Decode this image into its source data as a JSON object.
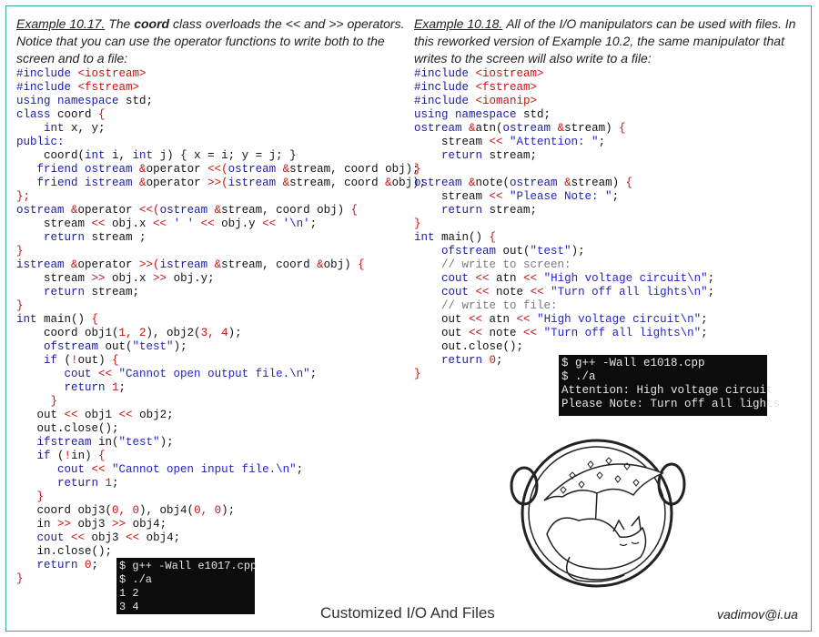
{
  "left": {
    "example_label": "Example 10.17.",
    "intro_pre": "The ",
    "intro_keyword": "coord",
    "intro_post": " class overloads the << and >> operators. Notice that you can use the operator functions to write both to the screen and to a file:",
    "code": [
      [
        [
          "k",
          "#include "
        ],
        [
          "r",
          "<iostream>"
        ]
      ],
      [
        [
          "k",
          "#include "
        ],
        [
          "r",
          "<fstream>"
        ]
      ],
      [
        [
          "k",
          "using namespace "
        ],
        [
          "t",
          "std;"
        ]
      ],
      [
        [
          "k",
          "class "
        ],
        [
          "t",
          "coord "
        ],
        [
          "r",
          "{"
        ]
      ],
      [
        [
          "t",
          "    "
        ],
        [
          "k",
          "int "
        ],
        [
          "t",
          "x, y;"
        ]
      ],
      [
        [
          "k",
          "public:"
        ]
      ],
      [
        [
          "t",
          "    coord("
        ],
        [
          "k",
          "int "
        ],
        [
          "t",
          "i, "
        ],
        [
          "k",
          "int "
        ],
        [
          "t",
          "j) { x = i; y = j; }"
        ]
      ],
      [
        [
          "t",
          "   "
        ],
        [
          "k",
          "friend ostream "
        ],
        [
          "r",
          "&"
        ],
        [
          "t",
          "operator "
        ],
        [
          "r",
          "<<("
        ],
        [
          "k",
          "ostream "
        ],
        [
          "r",
          "&"
        ],
        [
          "t",
          "stream, coord obj);"
        ]
      ],
      [
        [
          "t",
          "   "
        ],
        [
          "k",
          "friend istream "
        ],
        [
          "r",
          "&"
        ],
        [
          "t",
          "operator "
        ],
        [
          "r",
          ">>("
        ],
        [
          "k",
          "istream "
        ],
        [
          "r",
          "&"
        ],
        [
          "t",
          "stream, coord "
        ],
        [
          "r",
          "&"
        ],
        [
          "t",
          "obj);"
        ]
      ],
      [
        [
          "r",
          "};"
        ]
      ],
      [
        [
          "k",
          "ostream "
        ],
        [
          "r",
          "&"
        ],
        [
          "t",
          "operator "
        ],
        [
          "r",
          "<<("
        ],
        [
          "k",
          "ostream "
        ],
        [
          "r",
          "&"
        ],
        [
          "t",
          "stream, coord obj) "
        ],
        [
          "r",
          "{"
        ]
      ],
      [
        [
          "t",
          "    stream "
        ],
        [
          "r",
          "<< "
        ],
        [
          "t",
          "obj.x "
        ],
        [
          "r",
          "<< "
        ],
        [
          "s",
          "' ' "
        ],
        [
          "r",
          "<< "
        ],
        [
          "t",
          "obj.y "
        ],
        [
          "r",
          "<< "
        ],
        [
          "s",
          "'\\n'"
        ],
        [
          "t",
          ";"
        ]
      ],
      [
        [
          "t",
          "    "
        ],
        [
          "k",
          "return "
        ],
        [
          "t",
          "stream ;"
        ]
      ],
      [
        [
          "r",
          "}"
        ]
      ],
      [
        [
          "k",
          "istream "
        ],
        [
          "r",
          "&"
        ],
        [
          "t",
          "operator "
        ],
        [
          "r",
          ">>("
        ],
        [
          "k",
          "istream "
        ],
        [
          "r",
          "&"
        ],
        [
          "t",
          "stream, coord "
        ],
        [
          "r",
          "&"
        ],
        [
          "t",
          "obj) "
        ],
        [
          "r",
          "{"
        ]
      ],
      [
        [
          "t",
          "    stream "
        ],
        [
          "r",
          ">> "
        ],
        [
          "t",
          "obj.x "
        ],
        [
          "r",
          ">> "
        ],
        [
          "t",
          "obj.y;"
        ]
      ],
      [
        [
          "t",
          "    "
        ],
        [
          "k",
          "return "
        ],
        [
          "t",
          "stream;"
        ]
      ],
      [
        [
          "r",
          "}"
        ]
      ],
      [
        [
          "k",
          "int "
        ],
        [
          "t",
          "main() "
        ],
        [
          "r",
          "{"
        ]
      ],
      [
        [
          "t",
          "    coord obj1("
        ],
        [
          "r",
          "1, 2"
        ],
        [
          "t",
          "), obj2("
        ],
        [
          "r",
          "3, 4"
        ],
        [
          "t",
          ");"
        ]
      ],
      [
        [
          "t",
          "    "
        ],
        [
          "k",
          "ofstream "
        ],
        [
          "t",
          "out("
        ],
        [
          "s",
          "\"test\""
        ],
        [
          "t",
          ");"
        ]
      ],
      [
        [
          "t",
          "    "
        ],
        [
          "k",
          "if "
        ],
        [
          "t",
          "("
        ],
        [
          "r",
          "!"
        ],
        [
          "t",
          "out) "
        ],
        [
          "r",
          "{"
        ]
      ],
      [
        [
          "t",
          "       "
        ],
        [
          "k",
          "cout "
        ],
        [
          "r",
          "<< "
        ],
        [
          "s",
          "\"Cannot open output file.\\n\""
        ],
        [
          "t",
          ";"
        ]
      ],
      [
        [
          "t",
          "       "
        ],
        [
          "k",
          "return "
        ],
        [
          "r",
          "1"
        ],
        [
          "t",
          ";"
        ]
      ],
      [
        [
          "t",
          "     "
        ],
        [
          "r",
          "}"
        ]
      ],
      [
        [
          "t",
          "   out "
        ],
        [
          "r",
          "<< "
        ],
        [
          "t",
          "obj1 "
        ],
        [
          "r",
          "<< "
        ],
        [
          "t",
          "obj2;"
        ]
      ],
      [
        [
          "t",
          "   out.close();"
        ]
      ],
      [
        [
          "t",
          "   "
        ],
        [
          "k",
          "ifstream "
        ],
        [
          "t",
          "in("
        ],
        [
          "s",
          "\"test\""
        ],
        [
          "t",
          ");"
        ]
      ],
      [
        [
          "t",
          "   "
        ],
        [
          "k",
          "if "
        ],
        [
          "t",
          "("
        ],
        [
          "r",
          "!"
        ],
        [
          "t",
          "in) "
        ],
        [
          "r",
          "{"
        ]
      ],
      [
        [
          "t",
          "      "
        ],
        [
          "k",
          "cout "
        ],
        [
          "r",
          "<< "
        ],
        [
          "s",
          "\"Cannot open input file.\\n\""
        ],
        [
          "t",
          ";"
        ]
      ],
      [
        [
          "t",
          "      "
        ],
        [
          "k",
          "return "
        ],
        [
          "r",
          "1"
        ],
        [
          "t",
          ";"
        ]
      ],
      [
        [
          "t",
          "   "
        ],
        [
          "r",
          "}"
        ]
      ],
      [
        [
          "t",
          "   coord obj3("
        ],
        [
          "r",
          "0, 0"
        ],
        [
          "t",
          "), obj4("
        ],
        [
          "r",
          "0, 0"
        ],
        [
          "t",
          ");"
        ]
      ],
      [
        [
          "t",
          "   in "
        ],
        [
          "r",
          ">> "
        ],
        [
          "t",
          "obj3 "
        ],
        [
          "r",
          ">> "
        ],
        [
          "t",
          "obj4;"
        ]
      ],
      [
        [
          "t",
          "   "
        ],
        [
          "k",
          "cout "
        ],
        [
          "r",
          "<< "
        ],
        [
          "t",
          "obj3 "
        ],
        [
          "r",
          "<< "
        ],
        [
          "t",
          "obj4;"
        ]
      ],
      [
        [
          "t",
          "   in.close();"
        ]
      ],
      [
        [
          "t",
          "   "
        ],
        [
          "k",
          "return "
        ],
        [
          "r",
          "0"
        ],
        [
          "t",
          ";"
        ]
      ],
      [
        [
          "r",
          "}"
        ]
      ]
    ]
  },
  "right": {
    "example_label": "Example 10.18.",
    "intro": "All of the I/O manipulators can be used with files. In this reworked version of Example 10.2, the same manipulator that writes to the screen will also write to a file:",
    "code": [
      [
        [
          "k",
          "#include "
        ],
        [
          "r",
          "<iostream>"
        ]
      ],
      [
        [
          "k",
          "#include "
        ],
        [
          "r",
          "<fstream>"
        ]
      ],
      [
        [
          "k",
          "#include "
        ],
        [
          "r",
          "<iomanip>"
        ]
      ],
      [
        [
          "k",
          "using namespace "
        ],
        [
          "t",
          "std;"
        ]
      ],
      [
        [
          "k",
          "ostream "
        ],
        [
          "r",
          "&"
        ],
        [
          "t",
          "atn("
        ],
        [
          "k",
          "ostream "
        ],
        [
          "r",
          "&"
        ],
        [
          "t",
          "stream) "
        ],
        [
          "r",
          "{"
        ]
      ],
      [
        [
          "t",
          "    stream "
        ],
        [
          "r",
          "<< "
        ],
        [
          "s",
          "\"Attention: \""
        ],
        [
          "t",
          ";"
        ]
      ],
      [
        [
          "t",
          "    "
        ],
        [
          "k",
          "return "
        ],
        [
          "t",
          "stream;"
        ]
      ],
      [
        [
          "r",
          "}"
        ]
      ],
      [
        [
          "k",
          "ostream "
        ],
        [
          "r",
          "&"
        ],
        [
          "t",
          "note("
        ],
        [
          "k",
          "ostream "
        ],
        [
          "r",
          "&"
        ],
        [
          "t",
          "stream) "
        ],
        [
          "r",
          "{"
        ]
      ],
      [
        [
          "t",
          "    stream "
        ],
        [
          "r",
          "<< "
        ],
        [
          "s",
          "\"Please Note: \""
        ],
        [
          "t",
          ";"
        ]
      ],
      [
        [
          "t",
          "    "
        ],
        [
          "k",
          "return "
        ],
        [
          "t",
          "stream;"
        ]
      ],
      [
        [
          "r",
          "}"
        ]
      ],
      [
        [
          "k",
          "int "
        ],
        [
          "t",
          "main() "
        ],
        [
          "r",
          "{"
        ]
      ],
      [
        [
          "t",
          "    "
        ],
        [
          "k",
          "ofstream "
        ],
        [
          "t",
          "out("
        ],
        [
          "s",
          "\"test\""
        ],
        [
          "t",
          ");"
        ]
      ],
      [
        [
          "t",
          "    "
        ],
        [
          "c",
          "// write to screen:"
        ]
      ],
      [
        [
          "t",
          "    "
        ],
        [
          "k",
          "cout "
        ],
        [
          "r",
          "<< "
        ],
        [
          "t",
          "atn "
        ],
        [
          "r",
          "<< "
        ],
        [
          "s",
          "\"High voltage circuit\\n\""
        ],
        [
          "t",
          ";"
        ]
      ],
      [
        [
          "t",
          "    "
        ],
        [
          "k",
          "cout "
        ],
        [
          "r",
          "<< "
        ],
        [
          "t",
          "note "
        ],
        [
          "r",
          "<< "
        ],
        [
          "s",
          "\"Turn off all lights\\n\""
        ],
        [
          "t",
          ";"
        ]
      ],
      [
        [
          "t",
          "    "
        ],
        [
          "c",
          "// write to file:"
        ]
      ],
      [
        [
          "t",
          "    out "
        ],
        [
          "r",
          "<< "
        ],
        [
          "t",
          "atn "
        ],
        [
          "r",
          "<< "
        ],
        [
          "s",
          "\"High voltage circuit\\n\""
        ],
        [
          "t",
          ";"
        ]
      ],
      [
        [
          "t",
          "    out "
        ],
        [
          "r",
          "<< "
        ],
        [
          "t",
          "note "
        ],
        [
          "r",
          "<< "
        ],
        [
          "s",
          "\"Turn off all lights\\n\""
        ],
        [
          "t",
          ";"
        ]
      ],
      [
        [
          "t",
          "    out.close();"
        ]
      ],
      [
        [
          "t",
          "    "
        ],
        [
          "k",
          "return "
        ],
        [
          "r",
          "0"
        ],
        [
          "t",
          ";"
        ]
      ],
      [
        [
          "r",
          "}"
        ]
      ]
    ]
  },
  "terminal1": [
    "$ g++ -Wall e1017.cpp",
    "$ ./a",
    "1 2",
    "3 4"
  ],
  "terminal2": [
    "$ g++ -Wall e1018.cpp",
    "$ ./a",
    "Attention: High voltage circuit",
    "Please Note: Turn off all lights"
  ],
  "footer": {
    "title": "Customized I/O And Files",
    "email": "vadimov@i.ua"
  },
  "colors": {
    "keyword": "#1a1aa6",
    "operator": "#cc1111",
    "string": "#2424c8",
    "comment": "#7a7a7a",
    "border": "#3aa6a6",
    "terminal_bg": "#0c0c0c"
  },
  "illustration": "sleeping-cat-umbrella-icon"
}
